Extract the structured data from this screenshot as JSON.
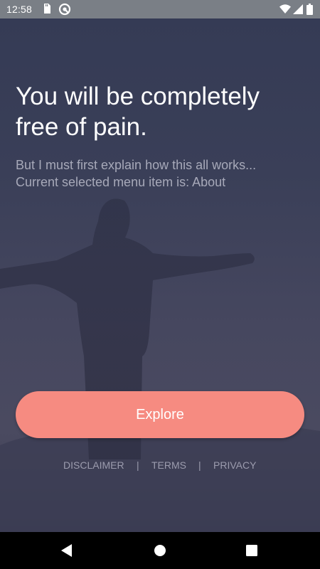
{
  "status_bar": {
    "time": "12:58",
    "icons": [
      "sd-card-icon",
      "vpn-icon",
      "wifi-icon",
      "signal-icon",
      "battery-icon"
    ]
  },
  "hero": {
    "title": "You will be completely free of pain.",
    "subtitle_line1": "But I must first explain how this all works...",
    "subtitle_line2": "Current selected menu item is: About"
  },
  "actions": {
    "explore_label": "Explore"
  },
  "footer": {
    "disclaimer": "DISCLAIMER",
    "separator": "|",
    "terms": "TERMS",
    "privacy": "PRIVACY"
  },
  "nav": {
    "icons": [
      "back-icon",
      "home-icon",
      "recents-icon"
    ]
  },
  "colors": {
    "accent": "#f68b81",
    "background_top": "#353b55",
    "subtitle": "#a7a9b9",
    "footer_text": "#9c9cae"
  }
}
